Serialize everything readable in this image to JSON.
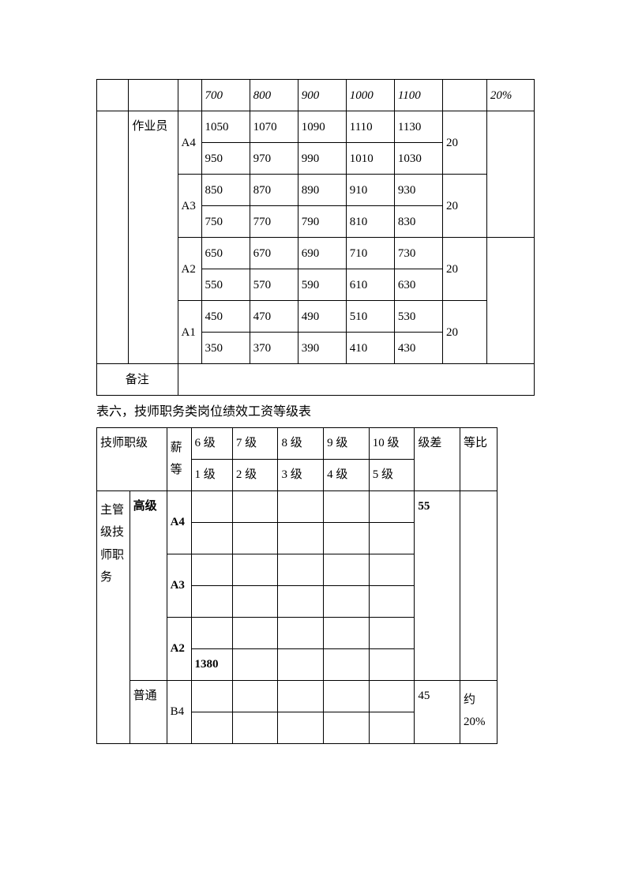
{
  "table1": {
    "r0": {
      "v1": "700",
      "v2": "800",
      "v3": "900",
      "v4": "1000",
      "v5": "1100",
      "pct": "20%"
    },
    "role": "作业员",
    "a4": {
      "lab": "A4",
      "t": [
        "1050",
        "1070",
        "1090",
        "1110",
        "1130"
      ],
      "b": [
        "950",
        "970",
        "990",
        "1010",
        "1030"
      ],
      "diff": "20"
    },
    "a3": {
      "lab": "A3",
      "t": [
        "850",
        "870",
        "890",
        "910",
        "930"
      ],
      "b": [
        "750",
        "770",
        "790",
        "810",
        "830"
      ],
      "diff": "20"
    },
    "a2": {
      "lab": "A2",
      "t": [
        "650",
        "670",
        "690",
        "710",
        "730"
      ],
      "b": [
        "550",
        "570",
        "590",
        "610",
        "630"
      ],
      "diff": "20"
    },
    "a1": {
      "lab": "A1",
      "t": [
        "450",
        "470",
        "490",
        "510",
        "530"
      ],
      "b": [
        "350",
        "370",
        "390",
        "410",
        "430"
      ],
      "diff": "20"
    },
    "note": "备注"
  },
  "caption": "表六，技师职务类岗位绩效工资等级表",
  "table2": {
    "h_role": "技师职级",
    "h_pay": "薪等",
    "h_cols_top": [
      "6 级",
      "7 级",
      "8 级",
      "9 级",
      "10 级"
    ],
    "h_cols_bot": [
      "1 级",
      "2 级",
      "3 级",
      "4 级",
      "5 级"
    ],
    "h_diff": "级差",
    "h_ratio": "等比",
    "group1": "主管级技师职务",
    "lvl_high": "高级",
    "a4": "A4",
    "a3": "A3",
    "a2": "A2",
    "a2_val": "1380",
    "diff_high": "55",
    "lvl_norm": "普通",
    "b4": "B4",
    "diff_norm": "45",
    "ratio_norm": "约20%"
  }
}
